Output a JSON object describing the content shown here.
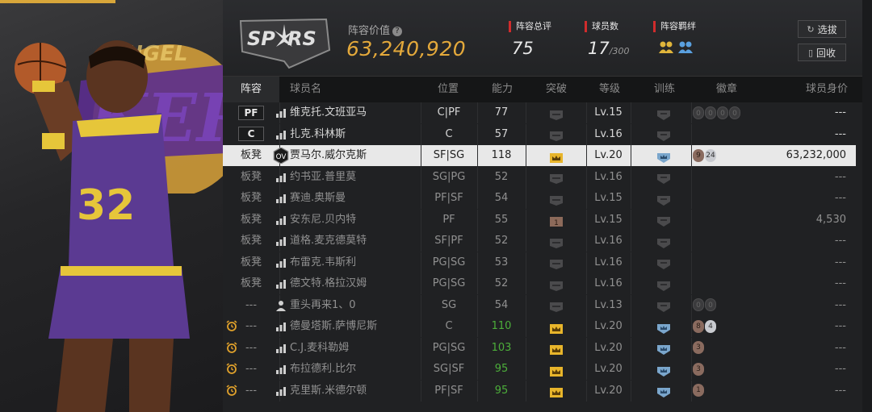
{
  "team": {
    "value_label": "阵容价值",
    "value": "63,240,920"
  },
  "stats": [
    {
      "label": "阵容总评",
      "value": "75",
      "suffix": ""
    },
    {
      "label": "球员数",
      "value": "17",
      "suffix": "/300"
    },
    {
      "label": "阵容羁绊",
      "value": "",
      "suffix": ""
    }
  ],
  "buttons": {
    "select": "选拔",
    "recycle": "回收"
  },
  "columns": [
    "阵容",
    "球员名",
    "位置",
    "能力",
    "突破",
    "等级",
    "训练",
    "徽章",
    "球员身价"
  ],
  "rows": [
    {
      "role": "PF",
      "role_type": "box",
      "alarm": false,
      "icon": "bars",
      "name": "维克托.文班亚马",
      "pos": "C|PF",
      "ability": "77",
      "ability_green": false,
      "brk": "empty",
      "level": "Lv.15",
      "train": "empty",
      "badges": [
        [
          "empty",
          "0"
        ],
        [
          "empty",
          "0"
        ],
        [
          "empty",
          "0"
        ],
        [
          "empty",
          "0"
        ]
      ],
      "price": "---",
      "selected": false
    },
    {
      "role": "C",
      "role_type": "box",
      "alarm": false,
      "icon": "bars",
      "name": "扎克.科林斯",
      "pos": "C",
      "ability": "57",
      "ability_green": false,
      "brk": "empty",
      "level": "Lv.16",
      "train": "empty",
      "badges": [],
      "price": "---",
      "selected": false
    },
    {
      "role": "板凳",
      "role_type": "text",
      "alarm": false,
      "icon": "ovr",
      "name": "贾马尔.威尔克斯",
      "pos": "SF|SG",
      "ability": "118",
      "ability_green": false,
      "brk": "gold",
      "level": "Lv.20",
      "train": "blue",
      "badges": [
        [
          "bronze",
          "9"
        ],
        [
          "silver",
          "24"
        ]
      ],
      "price": "63,232,000",
      "selected": true
    },
    {
      "role": "板凳",
      "role_type": "text",
      "alarm": false,
      "icon": "bars",
      "name": "约书亚.普里莫",
      "pos": "SG|PG",
      "ability": "52",
      "ability_green": false,
      "brk": "empty",
      "level": "Lv.16",
      "train": "empty",
      "badges": [],
      "price": "---",
      "selected": false
    },
    {
      "role": "板凳",
      "role_type": "text",
      "alarm": false,
      "icon": "bars",
      "name": "赛迪.奥斯曼",
      "pos": "PF|SF",
      "ability": "54",
      "ability_green": false,
      "brk": "empty",
      "level": "Lv.15",
      "train": "empty",
      "badges": [],
      "price": "---",
      "selected": false
    },
    {
      "role": "板凳",
      "role_type": "text",
      "alarm": false,
      "icon": "bars",
      "name": "安东尼.贝内特",
      "pos": "PF",
      "ability": "55",
      "ability_green": false,
      "brk": "bronze1",
      "level": "Lv.15",
      "train": "empty",
      "badges": [],
      "price": "4,530",
      "selected": false
    },
    {
      "role": "板凳",
      "role_type": "text",
      "alarm": false,
      "icon": "bars",
      "name": "道格.麦克德莫特",
      "pos": "SF|PF",
      "ability": "52",
      "ability_green": false,
      "brk": "empty",
      "level": "Lv.16",
      "train": "empty",
      "badges": [],
      "price": "---",
      "selected": false
    },
    {
      "role": "板凳",
      "role_type": "text",
      "alarm": false,
      "icon": "bars",
      "name": "布雷克.韦斯利",
      "pos": "PG|SG",
      "ability": "53",
      "ability_green": false,
      "brk": "empty",
      "level": "Lv.16",
      "train": "empty",
      "badges": [],
      "price": "---",
      "selected": false
    },
    {
      "role": "板凳",
      "role_type": "text",
      "alarm": false,
      "icon": "bars",
      "name": "德文特.格拉汉姆",
      "pos": "PG|SG",
      "ability": "52",
      "ability_green": false,
      "brk": "empty",
      "level": "Lv.16",
      "train": "empty",
      "badges": [],
      "price": "---",
      "selected": false
    },
    {
      "role": "---",
      "role_type": "text",
      "alarm": false,
      "icon": "person",
      "name": "重头再来1、0",
      "pos": "SG",
      "ability": "54",
      "ability_green": false,
      "brk": "empty",
      "level": "Lv.13",
      "train": "empty",
      "badges": [
        [
          "empty",
          "0"
        ],
        [
          "empty",
          "0"
        ]
      ],
      "price": "---",
      "selected": false
    },
    {
      "role": "---",
      "role_type": "text",
      "alarm": true,
      "icon": "bars",
      "name": "德曼塔斯.萨博尼斯",
      "pos": "C",
      "ability": "110",
      "ability_green": true,
      "brk": "gold",
      "level": "Lv.20",
      "train": "blue",
      "badges": [
        [
          "bronze",
          "8"
        ],
        [
          "silver",
          "4"
        ]
      ],
      "price": "---",
      "selected": false
    },
    {
      "role": "---",
      "role_type": "text",
      "alarm": true,
      "icon": "bars",
      "name": "C.J.麦科勒姆",
      "pos": "PG|SG",
      "ability": "103",
      "ability_green": true,
      "brk": "gold",
      "level": "Lv.20",
      "train": "blue",
      "badges": [
        [
          "bronze",
          "3"
        ]
      ],
      "price": "---",
      "selected": false
    },
    {
      "role": "---",
      "role_type": "text",
      "alarm": true,
      "icon": "bars",
      "name": "布拉德利.比尔",
      "pos": "SG|SF",
      "ability": "95",
      "ability_green": true,
      "brk": "gold",
      "level": "Lv.20",
      "train": "blue",
      "badges": [
        [
          "bronze",
          "3"
        ]
      ],
      "price": "---",
      "selected": false
    },
    {
      "role": "---",
      "role_type": "text",
      "alarm": true,
      "icon": "bars",
      "name": "克里斯.米德尔顿",
      "pos": "PF|SF",
      "ability": "95",
      "ability_green": true,
      "brk": "gold",
      "level": "Lv.20",
      "train": "blue",
      "badges": [
        [
          "bronze",
          "1"
        ]
      ],
      "price": "---",
      "selected": false
    }
  ]
}
